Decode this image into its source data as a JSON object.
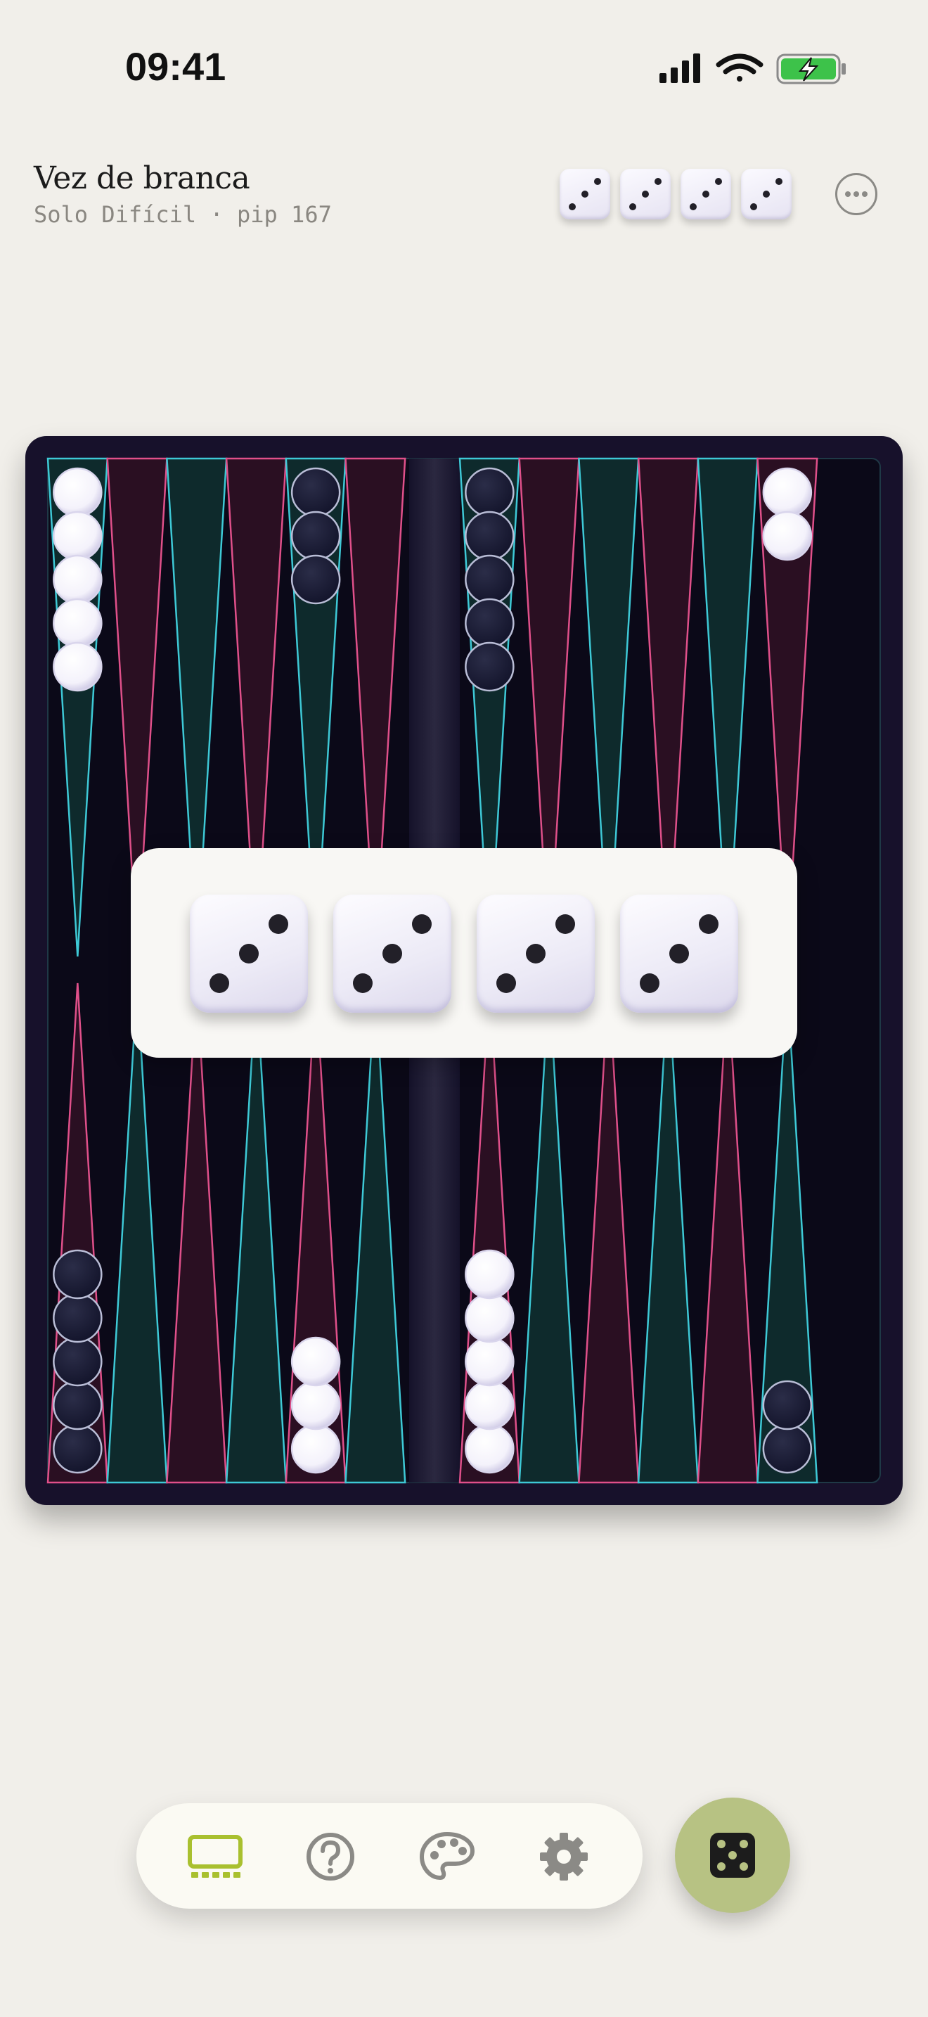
{
  "status": {
    "time": "09:41",
    "icons": [
      "cellular-signal-icon",
      "wifi-icon",
      "battery-charging-icon"
    ]
  },
  "header": {
    "title": "Vez de branca",
    "subtitle": "Solo Difícil · pip 167",
    "mini_dice": [
      3,
      3,
      3,
      3
    ],
    "menu_icon": "ellipsis-circle-icon"
  },
  "dice_overlay": {
    "dice": [
      3,
      3,
      3,
      3
    ]
  },
  "board": {
    "colors": {
      "frame": "#17112b",
      "surface": "#0b0918",
      "teal_point": "#0e2a2c",
      "crimson_point": "#2a0f22",
      "teal_line": "#3ec9d6",
      "crimson_line": "#e0508a",
      "white_checker": "#f4f2fb",
      "black_checker": "#12132a"
    },
    "top_points": [
      {
        "white": 5,
        "black": 0
      },
      {
        "white": 0,
        "black": 0
      },
      {
        "white": 0,
        "black": 0
      },
      {
        "white": 0,
        "black": 0
      },
      {
        "white": 0,
        "black": 3
      },
      {
        "white": 0,
        "black": 0
      },
      {
        "white": 0,
        "black": 5
      },
      {
        "white": 0,
        "black": 0
      },
      {
        "white": 0,
        "black": 0
      },
      {
        "white": 0,
        "black": 0
      },
      {
        "white": 0,
        "black": 0
      },
      {
        "white": 2,
        "black": 0
      }
    ],
    "bottom_points": [
      {
        "white": 0,
        "black": 5
      },
      {
        "white": 0,
        "black": 0
      },
      {
        "white": 0,
        "black": 0
      },
      {
        "white": 0,
        "black": 0
      },
      {
        "white": 3,
        "black": 0
      },
      {
        "white": 0,
        "black": 0
      },
      {
        "white": 5,
        "black": 0
      },
      {
        "white": 0,
        "black": 0
      },
      {
        "white": 0,
        "black": 0
      },
      {
        "white": 0,
        "black": 0
      },
      {
        "white": 0,
        "black": 0
      },
      {
        "white": 0,
        "black": 2
      }
    ]
  },
  "tab_bar": {
    "tabs": [
      {
        "name": "board",
        "icon": "board-icon",
        "active": true
      },
      {
        "name": "help",
        "icon": "question-circle-icon",
        "active": false
      },
      {
        "name": "theme",
        "icon": "palette-icon",
        "active": false
      },
      {
        "name": "settings",
        "icon": "gear-icon",
        "active": false
      }
    ],
    "accent": "#a9c02f",
    "icon_color": "#8b8a86",
    "roll_icon": "dice-icon",
    "roll_color": "#b7c283"
  }
}
